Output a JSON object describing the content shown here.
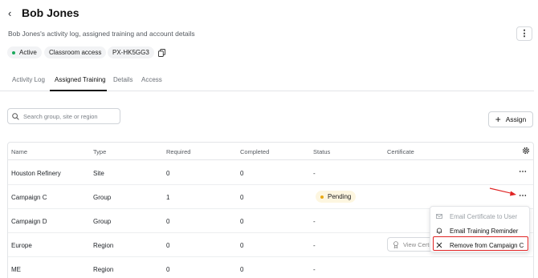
{
  "header": {
    "title": "Bob Jones",
    "subtitle": "Bob Jones's activity log, assigned training and account details",
    "chips": {
      "active": "Active",
      "access": "Classroom access",
      "id": "PX-HK5GG3"
    }
  },
  "tabs": [
    {
      "label": "Activity Log"
    },
    {
      "label": "Assigned Training",
      "active": true
    },
    {
      "label": "Details"
    },
    {
      "label": "Access"
    }
  ],
  "search": {
    "placeholder": "Search group, site or region"
  },
  "assign_label": "Assign",
  "table": {
    "columns": [
      "Name",
      "Type",
      "Required",
      "Completed",
      "Status",
      "Certificate"
    ],
    "rows": [
      {
        "name": "Houston Refinery",
        "type": "Site",
        "required": "0",
        "completed": "0",
        "status": "-"
      },
      {
        "name": "Campaign C",
        "type": "Group",
        "required": "1",
        "completed": "0",
        "status": "Pending"
      },
      {
        "name": "Campaign D",
        "type": "Group",
        "required": "0",
        "completed": "0",
        "status": "-"
      },
      {
        "name": "Europe",
        "type": "Region",
        "required": "0",
        "completed": "0",
        "status": "-",
        "certificate": "View Certificate"
      },
      {
        "name": "ME",
        "type": "Region",
        "required": "0",
        "completed": "0",
        "status": "-"
      }
    ]
  },
  "menu": {
    "items": [
      {
        "label": "Email Certificate to User",
        "disabled": true,
        "icon": "mail-icon"
      },
      {
        "label": "Email Training Reminder",
        "disabled": false,
        "icon": "bell-icon"
      },
      {
        "label": "Remove from Campaign C",
        "disabled": false,
        "icon": "close-icon"
      }
    ]
  },
  "colors": {
    "active_dot": "#1aa85c",
    "pending_dot": "#e8a914",
    "annotation": "#e02424"
  }
}
